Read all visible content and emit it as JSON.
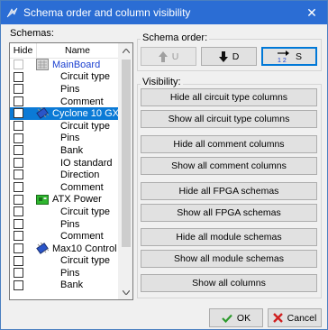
{
  "window": {
    "title": "Schema order and column visibility",
    "close_glyph": "✕"
  },
  "schemas_group": {
    "label": "Schemas:",
    "header": {
      "hide": "Hide",
      "name": "Name"
    },
    "rows": [
      {
        "type": "schema",
        "label": "MainBoard",
        "icon": "schematic-icon",
        "selected": false,
        "blue": true
      },
      {
        "type": "sub",
        "label": "Circuit type"
      },
      {
        "type": "sub",
        "label": "Pins"
      },
      {
        "type": "sub",
        "label": "Comment"
      },
      {
        "type": "schema",
        "label": "Cyclone 10 GX",
        "icon": "chip-icon",
        "selected": true
      },
      {
        "type": "sub",
        "label": "Circuit type"
      },
      {
        "type": "sub",
        "label": "Pins"
      },
      {
        "type": "sub",
        "label": "Bank"
      },
      {
        "type": "sub",
        "label": "IO standard"
      },
      {
        "type": "sub",
        "label": "Direction"
      },
      {
        "type": "sub",
        "label": "Comment"
      },
      {
        "type": "schema",
        "label": "ATX Power",
        "icon": "module-icon",
        "selected": false
      },
      {
        "type": "sub",
        "label": "Circuit type"
      },
      {
        "type": "sub",
        "label": "Pins"
      },
      {
        "type": "sub",
        "label": "Comment"
      },
      {
        "type": "schema",
        "label": "Max10 Control",
        "icon": "chip-icon",
        "selected": false
      },
      {
        "type": "sub",
        "label": "Circuit type"
      },
      {
        "type": "sub",
        "label": "Pins"
      },
      {
        "type": "sub",
        "label": "Bank"
      }
    ]
  },
  "order_group": {
    "label": "Schema order:",
    "up": "U",
    "down": "D",
    "sort": "S",
    "sort_icon_text": "1 2"
  },
  "visibility_group": {
    "label": "Visibility:",
    "buttons": [
      "Hide all circuit type columns",
      "Show all circuit type columns",
      "Hide all comment columns",
      "Show all comment columns",
      "Hide all FPGA schemas",
      "Show all FPGA schemas",
      "Hide all module schemas",
      "Show all module schemas",
      "Show all columns"
    ]
  },
  "footer": {
    "ok": "OK",
    "cancel": "Cancel"
  },
  "colors": {
    "titlebar": "#2b6dd4",
    "selection": "#0b7ad6",
    "link_blue": "#1a3fd0",
    "focus": "#0078d7"
  }
}
